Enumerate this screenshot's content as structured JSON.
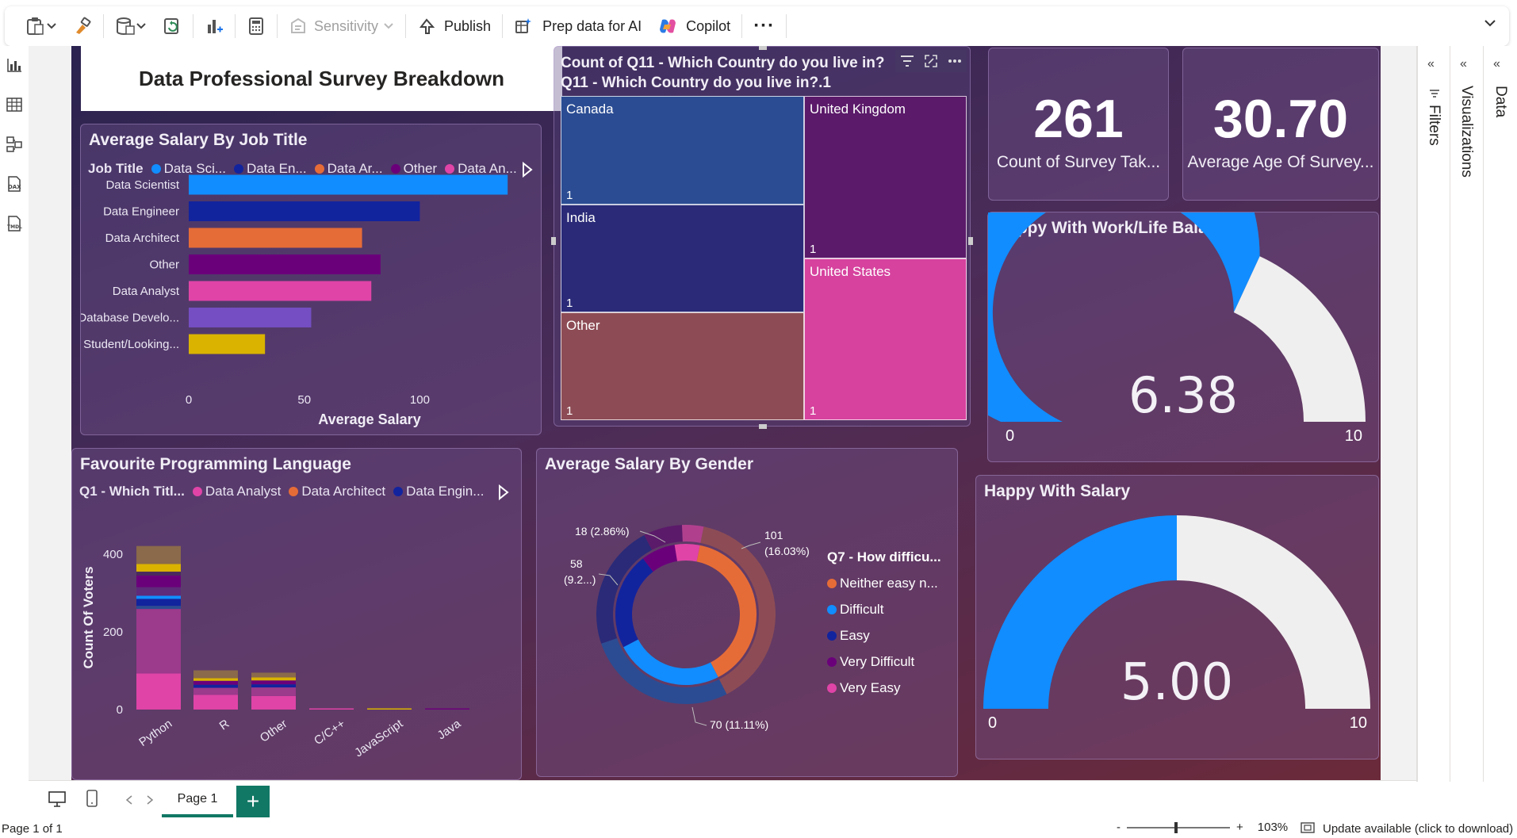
{
  "ribbon": {
    "sensitivity_label": "Sensitivity",
    "publish_label": "Publish",
    "prep_label": "Prep data for AI",
    "copilot_label": "Copilot",
    "more_label": "···"
  },
  "title_card": {
    "text": "Data Professional Survey Breakdown"
  },
  "salary_by_job": {
    "title": "Average Salary By Job Title",
    "legend_title": "Job Title",
    "legend": [
      "Data Sci...",
      "Data En...",
      "Data Ar...",
      "Other",
      "Data An..."
    ],
    "chart_data": {
      "type": "bar",
      "categories": [
        "Data Scientist",
        "Data Engineer",
        "Data Architect",
        "Other",
        "Data Analyst",
        "Database Develo...",
        "Student/Looking..."
      ],
      "values": [
        138,
        100,
        75,
        83,
        79,
        53,
        33
      ],
      "colors": [
        "#118dff",
        "#12239e",
        "#e66c37",
        "#6b007b",
        "#e044a7",
        "#744ec2",
        "#d9b300"
      ],
      "xticks": [
        "0",
        "50",
        "100"
      ],
      "xlim": [
        0,
        140
      ],
      "xlabel": "Average Salary"
    }
  },
  "treemap": {
    "title_line1": "Count of Q11 - Which Country do you live in?",
    "title_line2": "Q11 - Which Country do you live in?.1",
    "tiles": [
      {
        "name": "Canada",
        "value": "1",
        "color": "#2b4c93"
      },
      {
        "name": "United Kingdom",
        "value": "1",
        "color": "#5b1a6a"
      },
      {
        "name": "India",
        "value": "1",
        "color": "#2a2a78"
      },
      {
        "name": "United States",
        "value": "1",
        "color": "#d6429e"
      },
      {
        "name": "Other",
        "value": "1",
        "color": "#8d4c55"
      }
    ]
  },
  "card_count": {
    "value": "261",
    "label": "Count of Survey Tak..."
  },
  "card_age": {
    "value": "30.70",
    "label": "Average Age Of Survey..."
  },
  "gauge_work": {
    "title": "Happy With Work/Life Balance",
    "value": 6.38,
    "value_label": "6.38",
    "min": "0",
    "max": "10"
  },
  "gauge_salary": {
    "title": "Happy With Salary",
    "value": 5.0,
    "value_label": "5.00",
    "min": "0",
    "max": "10"
  },
  "prog_lang": {
    "title": "Favourite Programming Language",
    "legend_title": "Q1 - Which Titl...",
    "legend": [
      "Data Analyst",
      "Data Architect",
      "Data Engin..."
    ],
    "ylabel": "Count Of Voters",
    "chart_data": {
      "type": "bar",
      "categories": [
        "Python",
        "R",
        "Other",
        "C/C++",
        "JavaScript",
        "Java"
      ],
      "totals": [
        421,
        101,
        95,
        3,
        2,
        1
      ],
      "ylim": [
        0,
        450
      ],
      "yticks": [
        "0",
        "200",
        "400"
      ],
      "segments": [
        [
          {
            "v": 93,
            "c": "#e044a7"
          },
          {
            "v": 166,
            "c": "#9c3a8c"
          },
          {
            "v": 8,
            "c": "#2b4c93"
          },
          {
            "v": 18,
            "c": "#12239e"
          },
          {
            "v": 8,
            "c": "#118dff"
          },
          {
            "v": 22,
            "c": "#5e2a7a"
          },
          {
            "v": 30,
            "c": "#6b007b"
          },
          {
            "v": 10,
            "c": "#4a2a5e"
          },
          {
            "v": 20,
            "c": "#d9b300"
          },
          {
            "v": 46,
            "c": "#8a6a4a"
          }
        ],
        [
          {
            "v": 38,
            "c": "#e044a7"
          },
          {
            "v": 18,
            "c": "#9c3a8c"
          },
          {
            "v": 8,
            "c": "#12239e"
          },
          {
            "v": 10,
            "c": "#6b007b"
          },
          {
            "v": 7,
            "c": "#d9b300"
          },
          {
            "v": 20,
            "c": "#8a6a4a"
          }
        ],
        [
          {
            "v": 35,
            "c": "#e044a7"
          },
          {
            "v": 22,
            "c": "#9c3a8c"
          },
          {
            "v": 8,
            "c": "#12239e"
          },
          {
            "v": 10,
            "c": "#6b007b"
          },
          {
            "v": 8,
            "c": "#d9b300"
          },
          {
            "v": 12,
            "c": "#8a6a4a"
          }
        ],
        [
          {
            "v": 3,
            "c": "#e044a7"
          }
        ],
        [
          {
            "v": 2,
            "c": "#d9b300"
          }
        ],
        [
          {
            "v": 1,
            "c": "#6b007b"
          }
        ]
      ]
    }
  },
  "salary_by_gender": {
    "title": "Average Salary By Gender",
    "legend_title": "Q7 - How difficu...",
    "legend": [
      {
        "label": "Neither easy n...",
        "color": "#e66c37"
      },
      {
        "label": "Difficult",
        "color": "#118dff"
      },
      {
        "label": "Easy",
        "color": "#12239e"
      },
      {
        "label": "Very Difficult",
        "color": "#6b007b"
      },
      {
        "label": "Very Easy",
        "color": "#e044a7"
      }
    ],
    "labels": {
      "l1": "18 (2.86%)",
      "l2a": "101",
      "l2b": "(16.03%)",
      "l3a": "58",
      "l3b": "(9.2...)",
      "l4": "70 (11.11%)"
    },
    "chart_data": {
      "type": "pie",
      "outer": [
        {
          "v": 101,
          "c": "#8d4c55"
        },
        {
          "v": 70,
          "c": "#2b4c93"
        },
        {
          "v": 58,
          "c": "#2a2a78"
        },
        {
          "v": 18,
          "c": "#5b1a6a"
        },
        {
          "v": 10,
          "c": "#b0408e"
        }
      ],
      "inner": [
        {
          "v": 150,
          "c": "#e66c37"
        },
        {
          "v": 95,
          "c": "#118dff"
        },
        {
          "v": 85,
          "c": "#12239e"
        },
        {
          "v": 30,
          "c": "#6b007b"
        },
        {
          "v": 22,
          "c": "#e044a7"
        }
      ]
    }
  },
  "panes": {
    "filters": "Filters",
    "visualizations": "Visualizations",
    "data": "Data"
  },
  "tabs": {
    "page1": "Page 1",
    "add": "+"
  },
  "status": {
    "page": "Page 1 of 1",
    "zoom_minus": "-",
    "zoom_plus": "+",
    "zoom": "103%",
    "update": "Update available (click to download)"
  }
}
